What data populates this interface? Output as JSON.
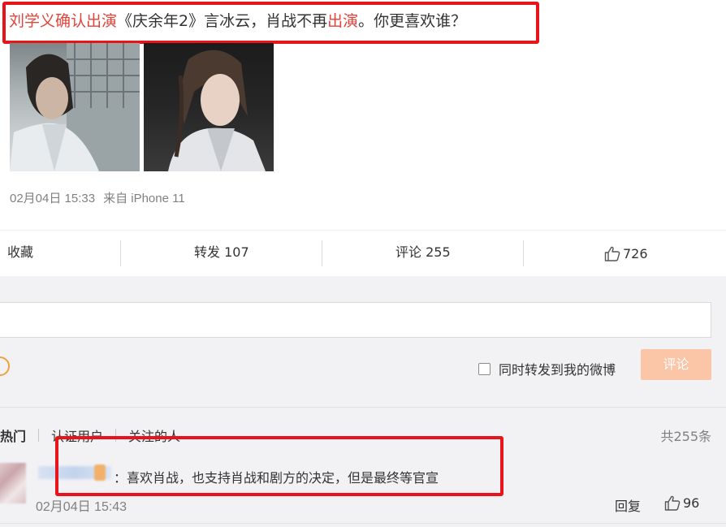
{
  "post": {
    "title_part1": "刘学义确认出演",
    "title_part2": "《庆余年2》言冰云，肖战不再",
    "title_part3": "出演",
    "title_part4": "。你更喜欢谁？",
    "date": "02月04日 15:33",
    "source": "来自 iPhone 11"
  },
  "actions": {
    "favorite": "收藏",
    "repost": "转发 107",
    "comment": "评论 255",
    "likes": "726"
  },
  "comment_box": {
    "repost_label": "同时转发到我的微博",
    "submit_label": "评论",
    "repost_checked": false
  },
  "comments_section": {
    "tabs": [
      "热门",
      "认证用户",
      "关注的人"
    ],
    "total": "共255条",
    "items": [
      {
        "text": "：喜欢肖战，也支持肖战和剧方的决定，但是最终等官宣",
        "time": "02月04日 15:43",
        "reply_label": "回复",
        "likes": "96"
      }
    ]
  },
  "colors": {
    "highlight_red": "#e0443a",
    "annotation_red": "#e8141b",
    "submit_disabled": "#fbc5a8"
  },
  "icons": [
    "thumbs-up-icon",
    "emoji-icon",
    "checkbox-icon"
  ]
}
